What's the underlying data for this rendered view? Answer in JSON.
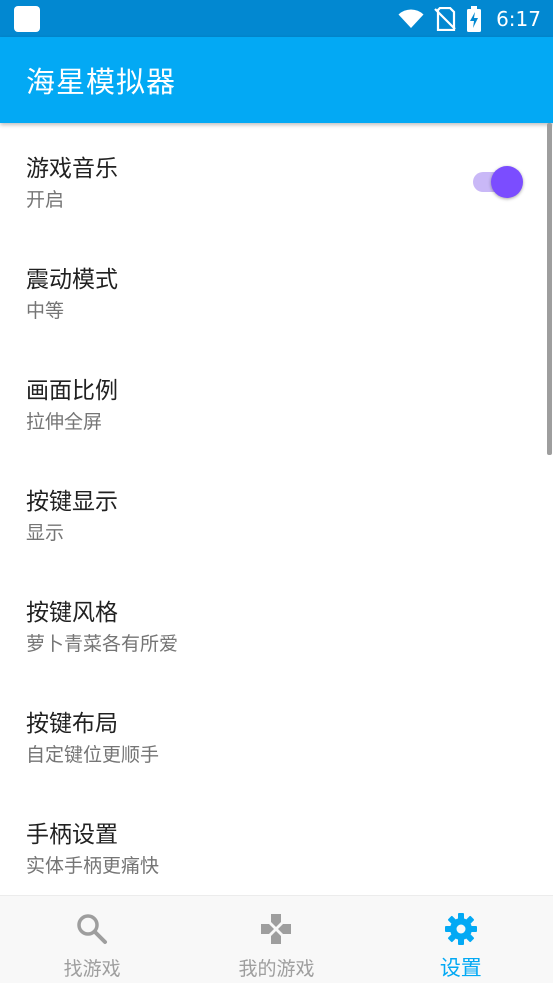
{
  "status_bar": {
    "time": "6:17"
  },
  "app_bar": {
    "title": "海星模拟器"
  },
  "settings": [
    {
      "title": "游戏音乐",
      "summary": "开启",
      "toggle": true
    },
    {
      "title": "震动模式",
      "summary": "中等"
    },
    {
      "title": "画面比例",
      "summary": "拉伸全屏"
    },
    {
      "title": "按键显示",
      "summary": "显示"
    },
    {
      "title": "按键风格",
      "summary": "萝卜青菜各有所爱"
    },
    {
      "title": "按键布局",
      "summary": "自定键位更顺手"
    },
    {
      "title": "手柄设置",
      "summary": "实体手柄更痛快"
    }
  ],
  "bottom_nav": [
    {
      "label": "找游戏",
      "icon": "search-icon",
      "active": false
    },
    {
      "label": "我的游戏",
      "icon": "gamepad-icon",
      "active": false
    },
    {
      "label": "设置",
      "icon": "gear-icon",
      "active": true
    }
  ],
  "colors": {
    "status_bar": "#0288d1",
    "app_bar": "#03a9f4",
    "accent": "#03a9f4",
    "toggle_thumb": "#7b4dff",
    "toggle_track": "#c9b8f7",
    "nav_inactive": "#9e9e9e"
  }
}
